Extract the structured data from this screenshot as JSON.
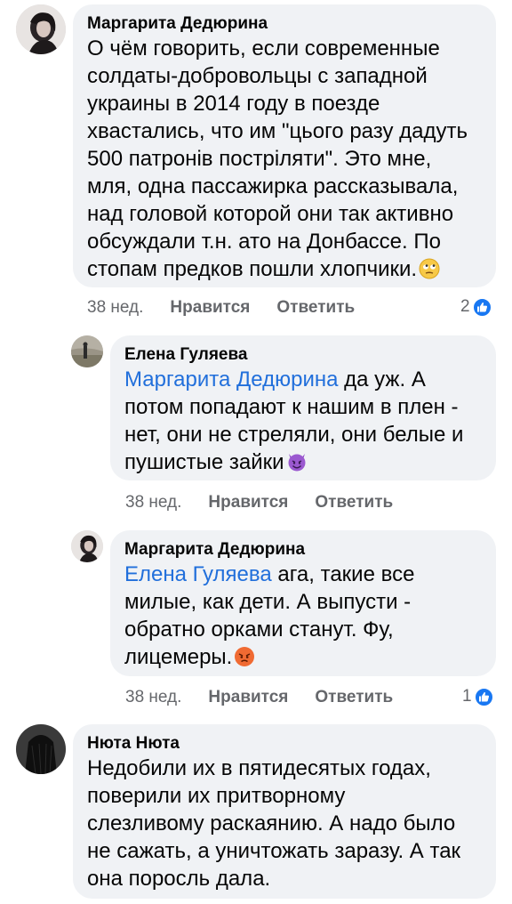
{
  "comments": [
    {
      "author": "Маргарита Дедюрина",
      "text": "О чём говорить, если современные\nсолдаты-добровольцы с западной\nукраины в 2014 году в поезде\nхвастались, что им \"цього разу дадуть\n500 патронів постріляти\". Это мне,\nмля, одна пассажирка рассказывала,\nнад головой которой они так активно\nобсуждали т.н. ато на Донбассе. По\nстопам предков пошли хлопчики.",
      "emoji": "eye-roll-emoji",
      "time": "38 нед.",
      "like_label": "Нравится",
      "reply_label": "Ответить",
      "reactions": "2"
    },
    {
      "author": "Елена Гуляева",
      "mention": "Маргарита Дедюрина",
      "text_first": " да уж. А",
      "text": "потом попадают к нашим в плен -\nнет, они не стреляли, они белые и\nпушистые зайки",
      "emoji": "devil-emoji",
      "time": "38 нед.",
      "like_label": "Нравится",
      "reply_label": "Ответить"
    },
    {
      "author": "Маргарита Дедюрина",
      "mention": "Елена Гуляева",
      "text_first": " ага, такие все",
      "text": "милые, как дети. А выпусти -\nобратно орками станут. Фу,\nлицемеры.",
      "emoji": "angry-emoji",
      "time": "38 нед.",
      "like_label": "Нравится",
      "reply_label": "Ответить",
      "reactions": "1"
    },
    {
      "author": "Нюта Нюта",
      "text": "Недобили их в пятидесятых годах,\nповерили их притворному\nслезливому раскаянию. А надо было\nне сажать, а уничтожать заразу. А так\nона поросль дала."
    }
  ],
  "colors": {
    "bubble": "#f0f2f5",
    "mention": "#216fdb",
    "secondary_text": "#65676b",
    "like_blue": "#1877f2"
  }
}
